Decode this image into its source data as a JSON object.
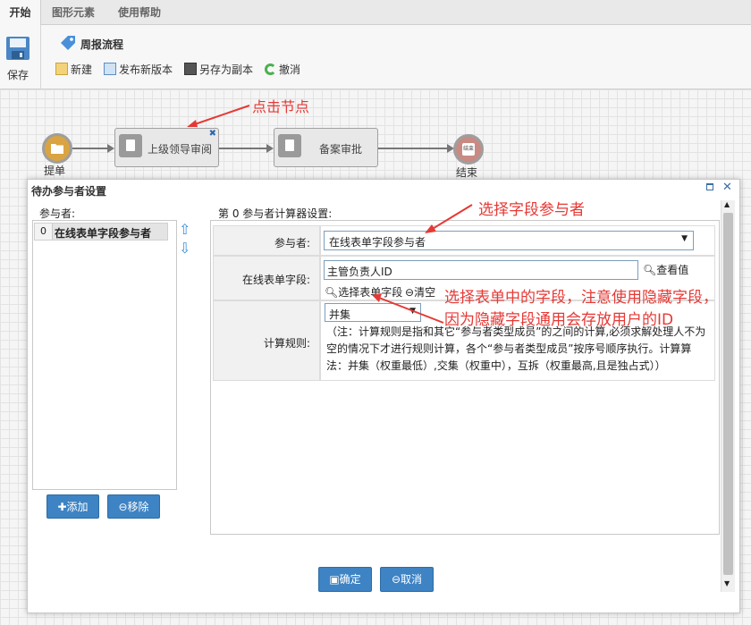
{
  "tabs": [
    "开始",
    "图形元素",
    "使用帮助"
  ],
  "toolbar": {
    "save": "保存",
    "flow_name": "周报流程",
    "new": "新建",
    "publish": "发布新版本",
    "save_as": "另存为副本",
    "undo": "撤消"
  },
  "flow": {
    "start_label": "提单",
    "node1": "上级领导审阅",
    "node2": "备案审批",
    "end_label": "结束",
    "end_inner": "结束"
  },
  "annotations": {
    "click_node": "点击节点",
    "select_field_participant": "选择字段参与者",
    "select_form_field_line1": "选择表单中的字段，注意使用隐藏字段，",
    "select_form_field_line2": "因为隐藏字段通用会存放用户的ID"
  },
  "dialog": {
    "title": "待办参与者设置",
    "participants_label": "参与者:",
    "participant_index": "0",
    "participant_item": "在线表单字段参与者",
    "add_button": "添加",
    "remove_button": "移除",
    "config_title": "第 0 参与者计算器设置:",
    "participant_field_label": "参与者:",
    "participant_select_value": "在线表单字段参与者",
    "form_field_label": "在线表单字段:",
    "form_field_value": "主管负责人ID",
    "view_value": "查看值",
    "select_form_field": "选择表单字段",
    "clear": "清空",
    "rule_label": "计算规则:",
    "rule_value": "并集",
    "rule_note": "（注：计算规则是指和其它“参与者类型成员”的之间的计算,必须求解处理人不为空的情况下才进行规则计算，各个“参与者类型成员”按序号顺序执行。计算算法：并集（权重最低）,交集（权重中），互拆（权重最高,且是独占式））",
    "ok_button": "确定",
    "cancel_button": "取消"
  },
  "colors": {
    "annotation": "#e53935",
    "primary_button": "#3e83c3",
    "ribbon_bg": "#f7f7f7"
  }
}
